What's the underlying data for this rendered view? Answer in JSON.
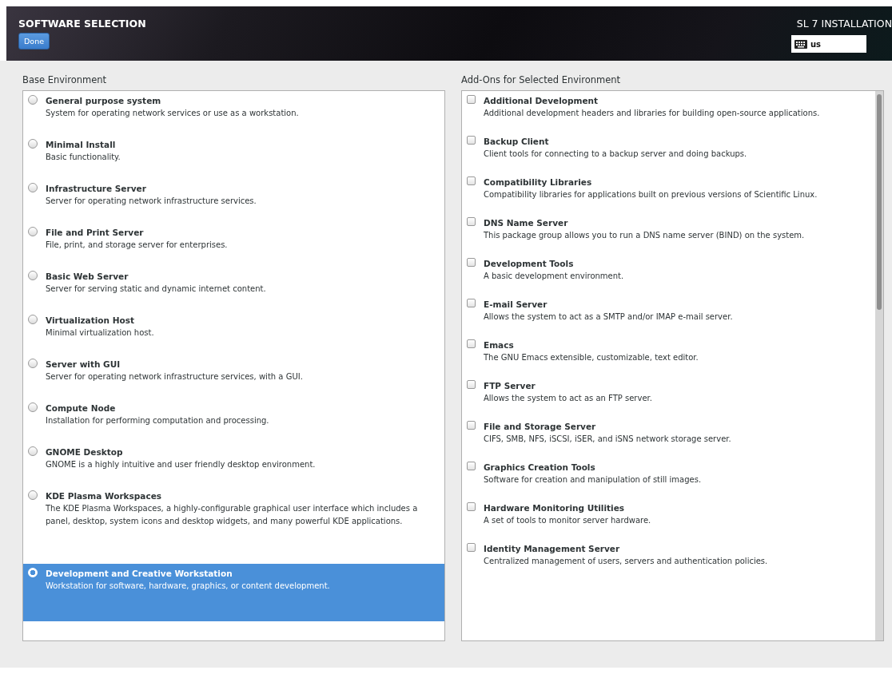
{
  "header": {
    "title": "SOFTWARE SELECTION",
    "done_button": "Done",
    "product": "SL 7 INSTALLATION",
    "keyboard_layout": "us"
  },
  "base_environment": {
    "heading": "Base Environment",
    "items": [
      {
        "name": "General purpose system",
        "description": "System for operating network services or use as a workstation.",
        "selected": false
      },
      {
        "name": "Minimal Install",
        "description": "Basic functionality.",
        "selected": false
      },
      {
        "name": "Infrastructure Server",
        "description": "Server for operating network infrastructure services.",
        "selected": false
      },
      {
        "name": "File and Print Server",
        "description": "File, print, and storage server for enterprises.",
        "selected": false
      },
      {
        "name": "Basic Web Server",
        "description": "Server for serving static and dynamic internet content.",
        "selected": false
      },
      {
        "name": "Virtualization Host",
        "description": "Minimal virtualization host.",
        "selected": false
      },
      {
        "name": "Server with GUI",
        "description": "Server for operating network infrastructure services, with a GUI.",
        "selected": false
      },
      {
        "name": "Compute Node",
        "description": "Installation for performing computation and processing.",
        "selected": false
      },
      {
        "name": "GNOME Desktop",
        "description": "GNOME is a highly intuitive and user friendly desktop environment.",
        "selected": false
      },
      {
        "name": "KDE Plasma Workspaces",
        "description": "The KDE Plasma Workspaces, a highly-configurable graphical user interface which includes a panel, desktop, system icons and desktop widgets, and many powerful KDE applications.",
        "selected": false
      },
      {
        "name": "Development and Creative Workstation",
        "description": "Workstation for software, hardware, graphics, or content development.",
        "selected": true
      }
    ]
  },
  "add_ons": {
    "heading": "Add-Ons for Selected Environment",
    "items": [
      {
        "name": "Additional Development",
        "description": "Additional development headers and libraries for building open-source applications.",
        "checked": false
      },
      {
        "name": "Backup Client",
        "description": "Client tools for connecting to a backup server and doing backups.",
        "checked": false
      },
      {
        "name": "Compatibility Libraries",
        "description": "Compatibility libraries for applications built on previous versions of Scientific Linux.",
        "checked": false
      },
      {
        "name": "DNS Name Server",
        "description": "This package group allows you to run a DNS name server (BIND) on the system.",
        "checked": false
      },
      {
        "name": "Development Tools",
        "description": "A basic development environment.",
        "checked": false
      },
      {
        "name": "E-mail Server",
        "description": "Allows the system to act as a SMTP and/or IMAP e-mail server.",
        "checked": false
      },
      {
        "name": "Emacs",
        "description": "The GNU Emacs extensible, customizable, text editor.",
        "checked": false
      },
      {
        "name": "FTP Server",
        "description": "Allows the system to act as an FTP server.",
        "checked": false
      },
      {
        "name": "File and Storage Server",
        "description": "CIFS, SMB, NFS, iSCSI, iSER, and iSNS network storage server.",
        "checked": false
      },
      {
        "name": "Graphics Creation Tools",
        "description": "Software for creation and manipulation of still images.",
        "checked": false
      },
      {
        "name": "Hardware Monitoring Utilities",
        "description": "A set of tools to monitor server hardware.",
        "checked": false
      },
      {
        "name": "Identity Management Server",
        "description": "Centralized management of users, servers and authentication policies.",
        "checked": false
      }
    ]
  }
}
